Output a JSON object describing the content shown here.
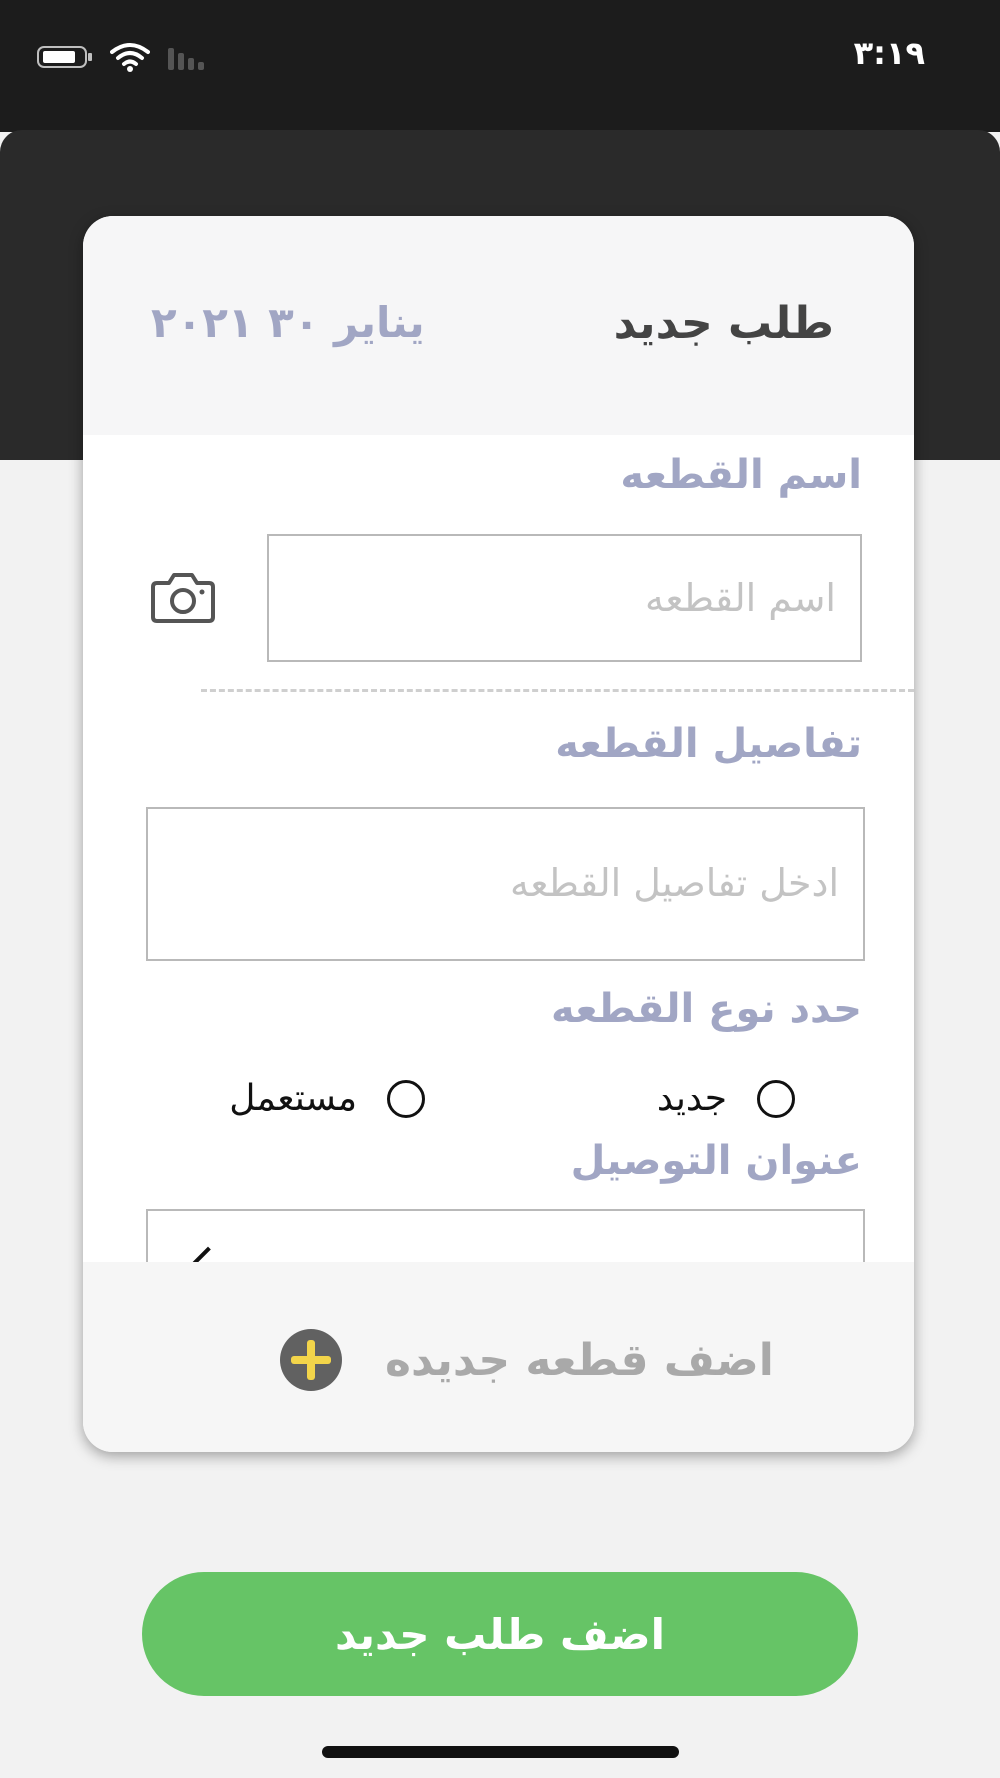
{
  "status_bar": {
    "time": "٣:١٩",
    "icons": [
      "battery-icon",
      "wifi-icon",
      "cellular-signal-icon"
    ]
  },
  "card": {
    "title": "طلب جديد",
    "date": "يناير ٣٠ ٢٠٢١",
    "part_name": {
      "label": "اسم القطعه",
      "placeholder": "اسم القطعه",
      "icon": "camera-icon"
    },
    "part_details": {
      "label": "تفاصيل القطعه",
      "placeholder": "ادخل تفاصيل القطعه"
    },
    "part_type": {
      "label": "حدد نوع القطعه",
      "options": [
        "جديد",
        "مستعمل"
      ]
    },
    "delivery_address": {
      "label": "عنوان التوصيل"
    },
    "add_part": {
      "label": "اضف قطعه جديده",
      "icon": "plus-circle-icon"
    }
  },
  "actions": {
    "add_order_label": "اضف طلب جديد"
  },
  "colors": {
    "label": "#a1a6c4",
    "primary_button": "#66c466",
    "plus_icon": "#f3d54a"
  }
}
